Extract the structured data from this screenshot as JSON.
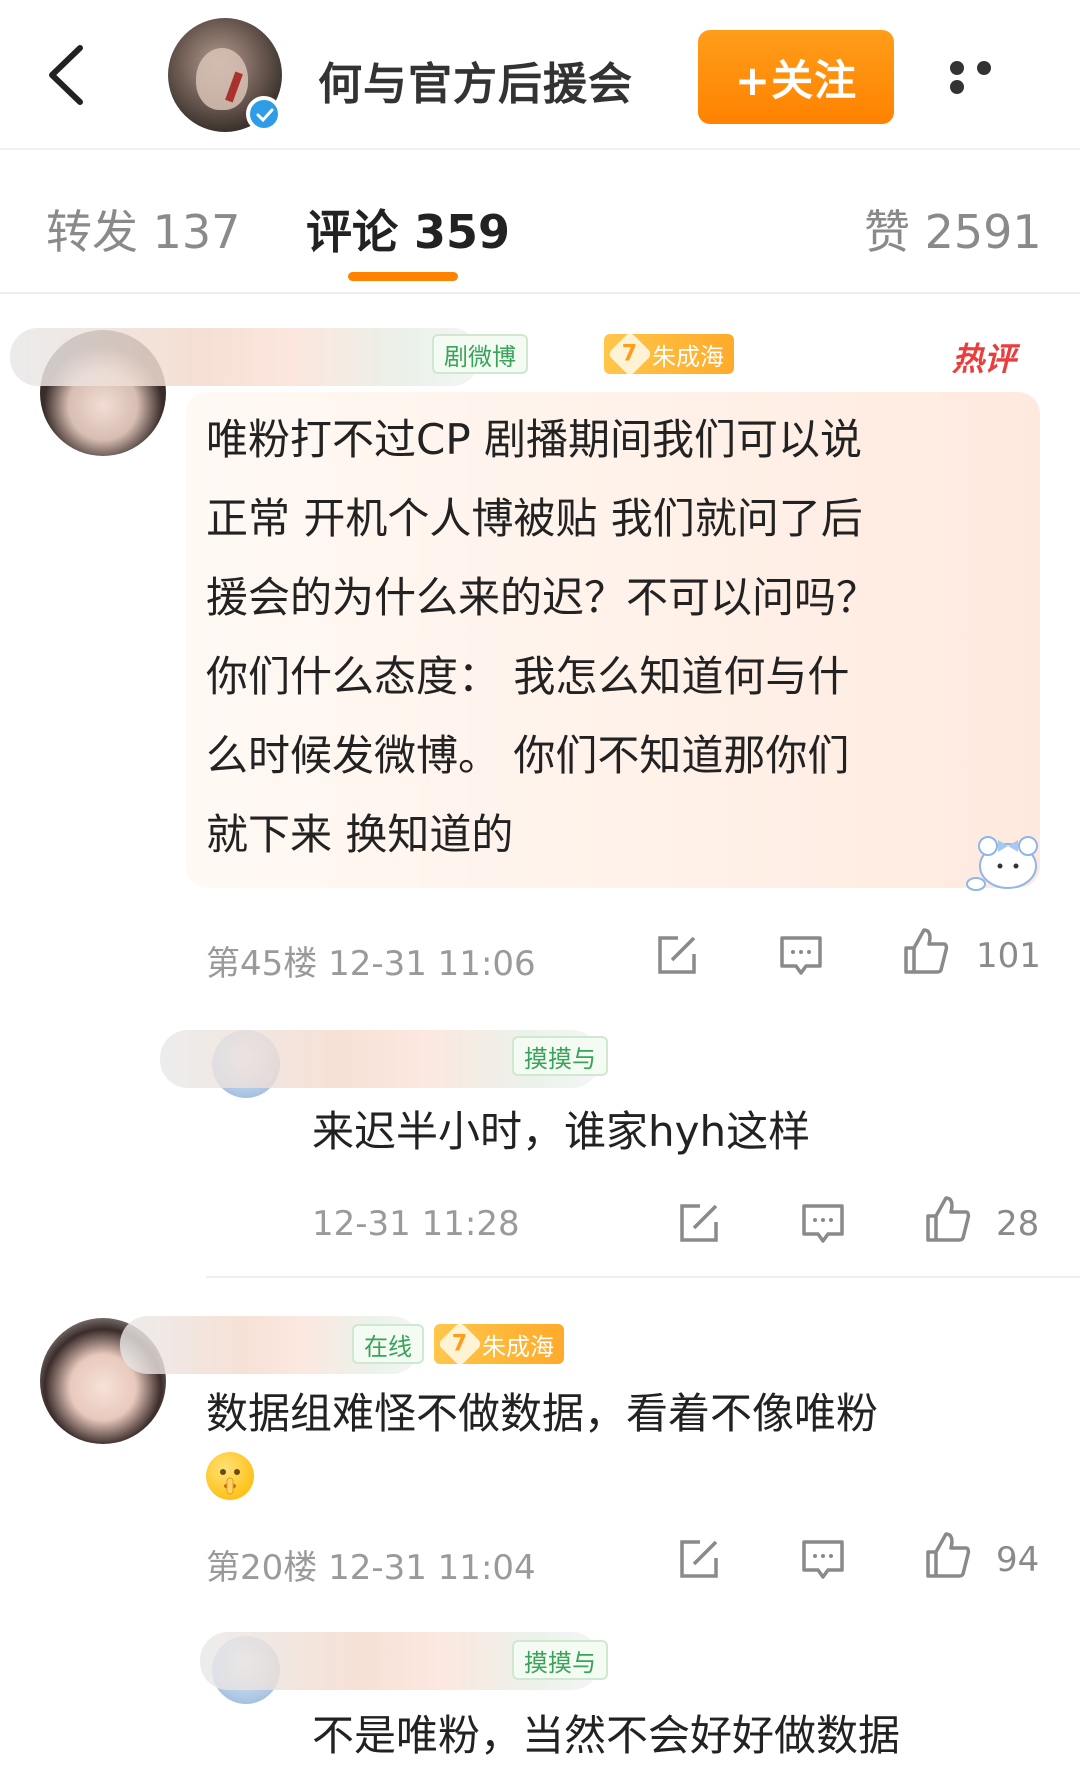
{
  "header": {
    "account_name": "何与官方后援会",
    "follow_label": "+关注",
    "back_icon": "chevron-left-icon",
    "more_icon": "more-dots-icon",
    "verified_color": "#2f9de6"
  },
  "tabs": [
    {
      "label": "转发 137",
      "active": false
    },
    {
      "label": "评论 359",
      "active": true
    },
    {
      "label": "赞 2591",
      "active": false
    }
  ],
  "colors": {
    "accent": "#ff8200",
    "hot": "#ec3d3d",
    "badge_green": "#3aa35a"
  },
  "comments": [
    {
      "badge": "剧微博",
      "fan_level": "7",
      "fan_name": "朱成海",
      "hot_tag": "热评",
      "lines": [
        "唯粉打不过CP 剧播期间我们可以说",
        "正常 开机个人博被贴 我们就问了后",
        "援会的为什么来的迟？不可以问吗？",
        "你们什么态度： 我怎么知道何与什",
        "么时候发微博。 你们不知道那你们",
        "就下来 换知道的"
      ],
      "floor_time": "第45楼 12-31 11:06",
      "likes": "101",
      "reply": {
        "badge": "摸摸与",
        "text": "来迟半小时，谁家hyh这样",
        "time": "12-31 11:28",
        "likes": "28"
      }
    },
    {
      "badge": "在线",
      "fan_level": "7",
      "fan_name": "朱成海",
      "text": "数据组难怪不做数据，看着不像唯粉",
      "emoji": "shush-face-emoji",
      "floor_time": "第20楼 12-31 11:04",
      "likes": "94",
      "reply": {
        "badge": "摸摸与",
        "text": "不是唯粉，当然不会好好做数据"
      }
    }
  ]
}
